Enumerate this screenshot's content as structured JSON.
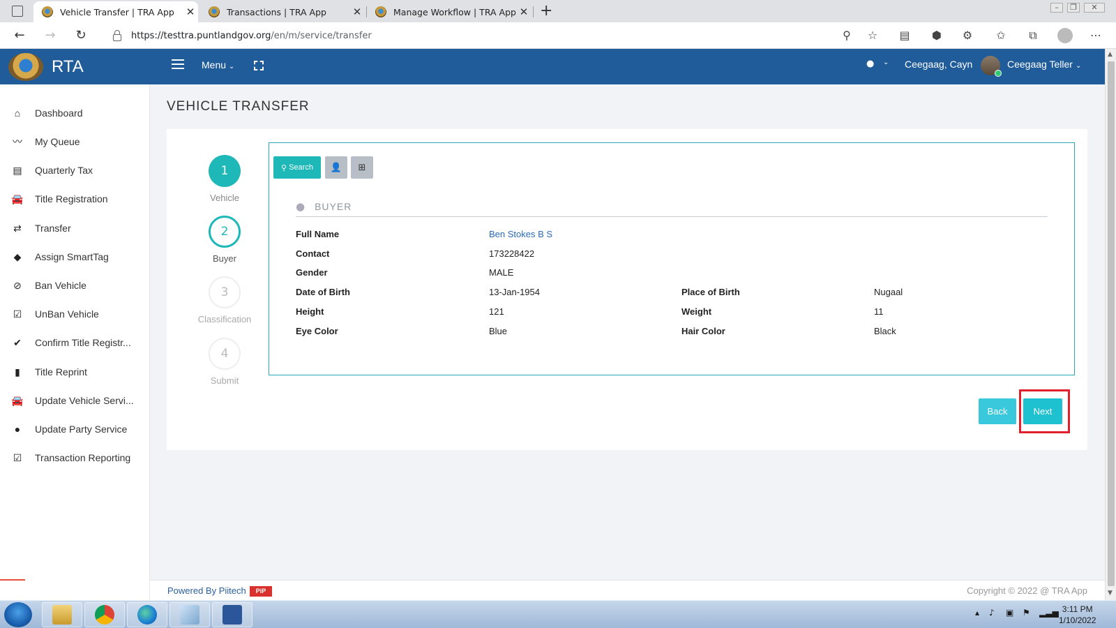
{
  "browser": {
    "tabs": [
      {
        "title": "Vehicle Transfer | TRA App",
        "active": true
      },
      {
        "title": "Transactions | TRA App",
        "active": false
      },
      {
        "title": "Manage Workflow | TRA App",
        "active": false
      }
    ],
    "url_host": "https://testtra.puntlandgov.org",
    "url_path": "/en/m/service/transfer"
  },
  "header": {
    "brand": "RTA",
    "menu_label": "Menu",
    "location": "Ceegaag, Cayn",
    "username": "Ceegaag Teller"
  },
  "sidebar": {
    "items": [
      {
        "label": "Dashboard",
        "icon": "home-icon"
      },
      {
        "label": "My Queue",
        "icon": "trend-icon"
      },
      {
        "label": "Quarterly Tax",
        "icon": "list-icon"
      },
      {
        "label": "Title Registration",
        "icon": "car-icon"
      },
      {
        "label": "Transfer",
        "icon": "exchange-icon"
      },
      {
        "label": "Assign SmartTag",
        "icon": "tags-icon"
      },
      {
        "label": "Ban Vehicle",
        "icon": "ban-icon"
      },
      {
        "label": "UnBan Vehicle",
        "icon": "checkbox-icon"
      },
      {
        "label": "Confirm Title Registr...",
        "icon": "check-icon"
      },
      {
        "label": "Title Reprint",
        "icon": "file-icon"
      },
      {
        "label": "Update Vehicle Servi...",
        "icon": "car-icon"
      },
      {
        "label": "Update Party Service",
        "icon": "user-icon"
      },
      {
        "label": "Transaction Reporting",
        "icon": "checkbox-icon"
      }
    ]
  },
  "page": {
    "title": "VEHICLE TRANSFER"
  },
  "steps": [
    {
      "num": "1",
      "label": "Vehicle",
      "state": "done"
    },
    {
      "num": "2",
      "label": "Buyer",
      "state": "current"
    },
    {
      "num": "3",
      "label": "Classification",
      "state": "todo"
    },
    {
      "num": "4",
      "label": "Submit",
      "state": "todo"
    }
  ],
  "toolbar": {
    "search_label": "Search"
  },
  "buyer": {
    "section_title": "BUYER",
    "full_name_label": "Full Name",
    "full_name": "Ben Stokes B S",
    "contact_label": "Contact",
    "contact": "173228422",
    "gender_label": "Gender",
    "gender": "MALE",
    "dob_label": "Date of Birth",
    "dob": "13-Jan-1954",
    "pob_label": "Place of Birth",
    "pob": "Nugaal",
    "height_label": "Height",
    "height": "121",
    "weight_label": "Weight",
    "weight": "11",
    "eye_label": "Eye Color",
    "eye": "Blue",
    "hair_label": "Hair Color",
    "hair": "Black"
  },
  "actions": {
    "back_label": "Back",
    "next_label": "Next"
  },
  "footer": {
    "powered": "Powered By Piitech",
    "badge": "PiP",
    "copyright": "Copyright © 2022 @ TRA App"
  },
  "taskbar": {
    "time": "3:11 PM",
    "date": "1/10/2022"
  },
  "colors": {
    "header_bg": "#1f5c99",
    "accent": "#1eb8b8",
    "highlight": "#e0202a"
  }
}
